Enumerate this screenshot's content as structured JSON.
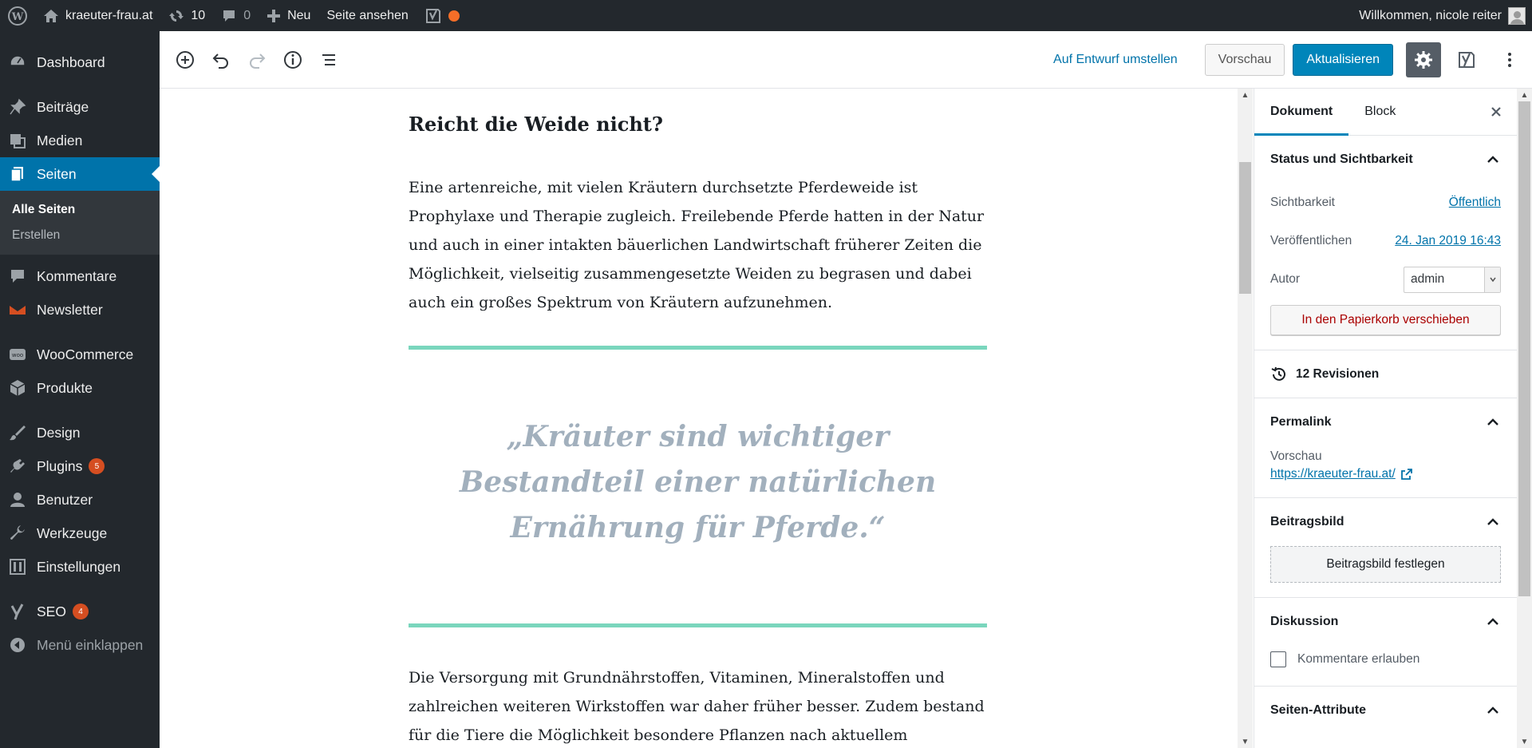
{
  "adminbar": {
    "site_name": "kraeuter-frau.at",
    "updates_count": "10",
    "comments_count": "0",
    "new_label": "Neu",
    "view_page_label": "Seite ansehen",
    "welcome": "Willkommen, nicole reiter"
  },
  "sidebar": {
    "items": [
      {
        "label": "Dashboard",
        "icon": "dashboard-icon"
      },
      {
        "label": "Beiträge",
        "icon": "pin-icon"
      },
      {
        "label": "Medien",
        "icon": "media-icon"
      },
      {
        "label": "Seiten",
        "icon": "pages-icon"
      },
      {
        "label": "Kommentare",
        "icon": "comment-icon"
      },
      {
        "label": "Newsletter",
        "icon": "mail-icon"
      },
      {
        "label": "WooCommerce",
        "icon": "woo-icon"
      },
      {
        "label": "Produkte",
        "icon": "box-icon"
      },
      {
        "label": "Design",
        "icon": "brush-icon"
      },
      {
        "label": "Plugins",
        "icon": "plugin-icon",
        "badge": "5"
      },
      {
        "label": "Benutzer",
        "icon": "user-icon"
      },
      {
        "label": "Werkzeuge",
        "icon": "wrench-icon"
      },
      {
        "label": "Einstellungen",
        "icon": "settings-icon"
      },
      {
        "label": "SEO",
        "icon": "yoast-icon",
        "badge": "4"
      },
      {
        "label": "Menü einklappen",
        "icon": "collapse-icon"
      }
    ],
    "submenu": [
      "Alle Seiten",
      "Erstellen"
    ]
  },
  "toolbar": {
    "switch_draft": "Auf Entwurf umstellen",
    "preview": "Vorschau",
    "update": "Aktualisieren"
  },
  "content": {
    "heading": "Reicht die Weide nicht?",
    "paragraph1": "Eine artenreiche, mit vielen Kräutern durchsetzte Pferdeweide ist Prophylaxe und Therapie zugleich. Freilebende Pferde hatten in der Natur und auch in einer intakten bäuerlichen Landwirtschaft früherer Zeiten die Möglichkeit, vielseitig zusammengesetzte Weiden zu begrasen und dabei auch ein großes Spektrum von Kräutern aufzunehmen.",
    "quote": "„Kräuter sind wichtiger Bestandteil einer natürlichen Ernährung für Pferde.“",
    "paragraph2": "Die Versorgung mit Grundnährstoffen, Vitaminen, Mineralstoffen und zahlreichen weiteren Wirkstoffen war daher früher besser. Zudem bestand für die Tiere die Möglichkeit besondere Pflanzen nach aktuellem Bedürfnis"
  },
  "panel": {
    "tab_document": "Dokument",
    "tab_block": "Block",
    "status_title": "Status und Sichtbarkeit",
    "visibility_label": "Sichtbarkeit",
    "visibility_value": "Öffentlich",
    "published_label": "Veröffentlichen",
    "published_value": "24. Jan 2019 16:43",
    "author_label": "Autor",
    "author_value": "admin",
    "trash_button": "In den Papierkorb verschieben",
    "revisions": "12 Revisionen",
    "permalink_title": "Permalink",
    "permalink_preview_label": "Vorschau",
    "permalink_url": "https://kraeuter-frau.at/",
    "featured_title": "Beitragsbild",
    "featured_button": "Beitragsbild festlegen",
    "discussion_title": "Diskussion",
    "allow_comments": "Kommentare erlauben",
    "page_attributes_title": "Seiten-Attribute"
  },
  "colors": {
    "adminbar_bg": "#23282d",
    "active_menu": "#0073aa",
    "primary_button": "#0085ba",
    "separator_green": "#7ad6bd",
    "quote_text": "#a2b0bd"
  }
}
